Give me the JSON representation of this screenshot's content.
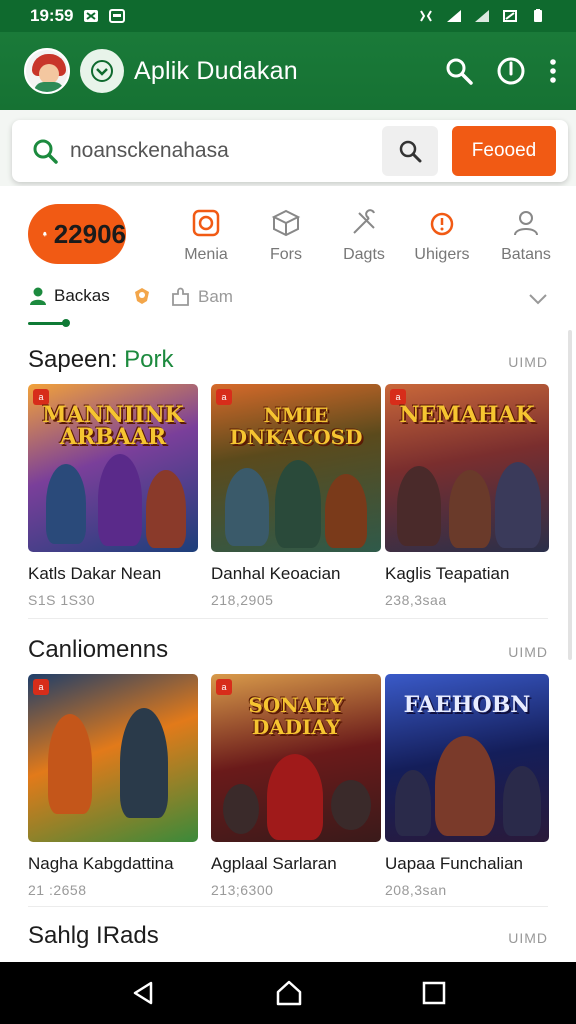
{
  "status_bar": {
    "time": "19:59"
  },
  "app_bar": {
    "title": "Aplik Dudakan"
  },
  "search": {
    "query": "noansckenahasa",
    "action_label": "Feooed"
  },
  "categories": {
    "points_value": "22906",
    "items": [
      {
        "label": "Menia",
        "icon": "clock-icon"
      },
      {
        "label": "Fors",
        "icon": "box-icon"
      },
      {
        "label": "Dagts",
        "icon": "tools-icon"
      },
      {
        "label": "Uhigers",
        "icon": "alert-icon"
      },
      {
        "label": "Batans",
        "icon": "person-icon"
      }
    ]
  },
  "tabs": [
    {
      "label": "Backas",
      "icon": "person-icon"
    },
    {
      "label": "",
      "icon": "badge-icon"
    },
    {
      "label": "Bam",
      "icon": "puzzle-icon"
    }
  ],
  "sections": [
    {
      "title": "Sapeen:",
      "title_accent": "Pork",
      "more": "UIMD",
      "cards": [
        {
          "logo": "MANNIINK ARBAAR",
          "title": "Katls Dakar Nean",
          "sub": "S1S 1S30",
          "colors": [
            "#1c3f7a",
            "#e08a2a",
            "#6b3aa0"
          ]
        },
        {
          "logo": "NMIE DNKACOSD",
          "title": "Danhal Keoacian",
          "sub": "218,2905",
          "colors": [
            "#5b4a1c",
            "#2f6b5a",
            "#c44a1a"
          ]
        },
        {
          "logo": "NEMAHAK",
          "title": "Kaglis Teapatian",
          "sub": "238,3saa",
          "colors": [
            "#7a2e2e",
            "#c9683a",
            "#2a2f4a"
          ]
        }
      ]
    },
    {
      "title": "Canliomenns",
      "title_accent": "",
      "more": "UIMD",
      "cards": [
        {
          "logo": "",
          "title": "Nagha Kabgdattina",
          "sub": "21 :2658",
          "colors": [
            "#1e3e6a",
            "#e27a1a",
            "#3a8a3a"
          ]
        },
        {
          "logo": "SONAEY DADIAY",
          "title": "Agplaal Sarlaran",
          "sub": "213;6300",
          "colors": [
            "#6a1a1a",
            "#d89a4a",
            "#3a1a1a"
          ]
        },
        {
          "logo": "FAEHOBN",
          "title": "Uapaa Funchalian",
          "sub": "208,3san",
          "colors": [
            "#141e5a",
            "#3a5ac8",
            "#a02a1a"
          ]
        }
      ]
    },
    {
      "title": "Sahlg IRads",
      "title_accent": "",
      "more": "UIMD"
    }
  ]
}
